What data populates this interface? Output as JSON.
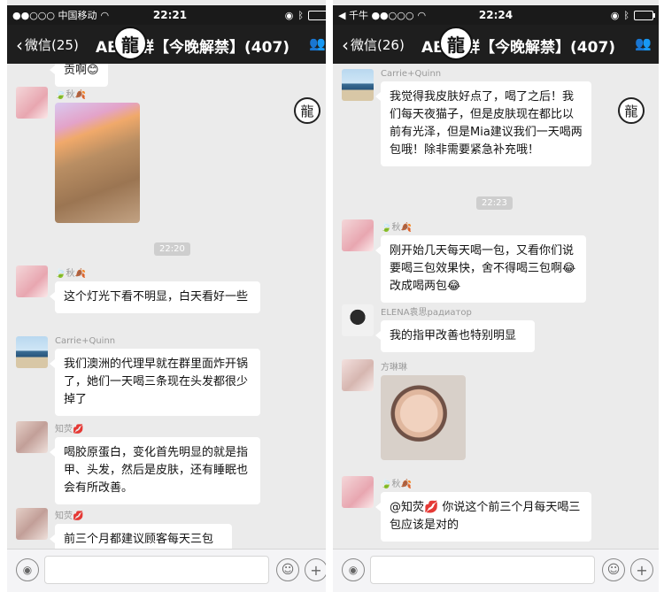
{
  "left": {
    "status": {
      "carrier": "●●○○○ 中国移动",
      "time": "22:21"
    },
    "nav": {
      "back_label": "微信(25)",
      "title": "AB    知群【今晚解禁】(407)"
    },
    "messages": [
      {
        "text": "贡啊😊"
      },
      {
        "sender": "🍃秋🍂",
        "type": "image"
      },
      {
        "time": "22:20"
      },
      {
        "sender": "🍃秋🍂",
        "text": "这个灯光下看不明显，白天看好一些"
      },
      {
        "sender": "Carrie+Quinn",
        "text": "我们澳洲的代理早就在群里面炸开锅了，她们一天喝三条现在头发都很少掉了"
      },
      {
        "sender": "知荧💋",
        "text": "喝胶原蛋白，变化首先明显的就是指甲、头发，然后是皮肤，还有睡眠也会有所改善。"
      },
      {
        "sender": "知荧💋",
        "text": "前三个月都建议顾客每天三包"
      }
    ]
  },
  "right": {
    "status": {
      "carrier": "◀ 千牛 ●●○○○",
      "time": "22:24"
    },
    "nav": {
      "back_label": "微信(26)",
      "title": "AB    知群【今晚解禁】(407)"
    },
    "messages": [
      {
        "sender": "Carrie+Quinn",
        "text": "我觉得我皮肤好点了，喝了之后！我们每天夜猫子，但是皮肤现在都比以前有光泽，但是Mia建议我们一天喝两包哦！除非需要紧急补充哦！"
      },
      {
        "time": "22:23"
      },
      {
        "sender": "🍃秋🍂",
        "text": "刚开始几天每天喝一包，又看你们说要喝三包效果快，舍不得喝三包啊😂 改成喝两包😂"
      },
      {
        "sender": "ELENA袁思радиатор",
        "text": "我的指甲改善也特别明显"
      },
      {
        "sender": "方琳琳",
        "type": "image"
      },
      {
        "sender": "🍃秋🍂",
        "text": "@知荧💋 你说这个前三个月每天喝三包应该是对的"
      }
    ]
  }
}
